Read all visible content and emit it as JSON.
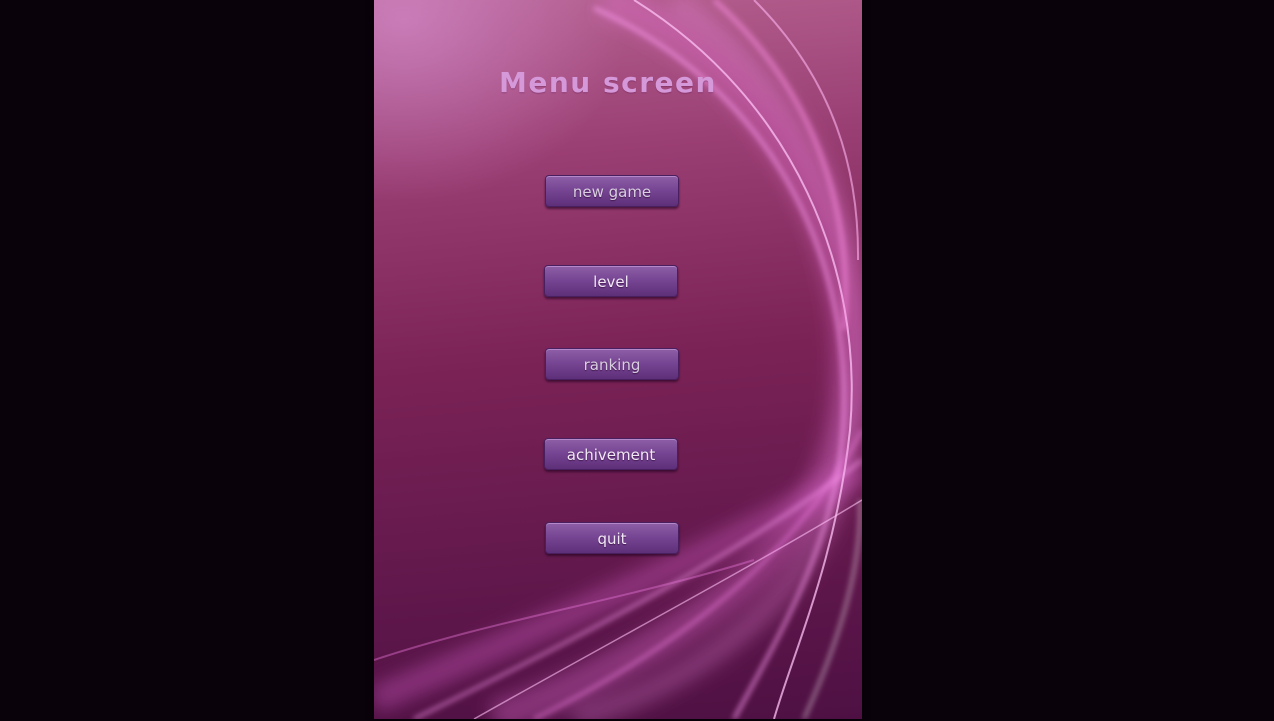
{
  "screen": {
    "title": "Menu screen"
  },
  "menu": {
    "buttons": [
      {
        "id": "new-game",
        "label": "new game"
      },
      {
        "id": "level",
        "label": "level"
      },
      {
        "id": "ranking",
        "label": "ranking"
      },
      {
        "id": "achivement",
        "label": "achivement"
      },
      {
        "id": "quit",
        "label": "quit"
      }
    ]
  },
  "colors": {
    "outer_background": "#0a020a",
    "panel_top": "#b4608f",
    "panel_bottom": "#4e1043",
    "title": "#d598d9",
    "button_fill": "#774694",
    "button_text": "#f2e8f5",
    "wisp_highlight": "#ff9cf2"
  }
}
